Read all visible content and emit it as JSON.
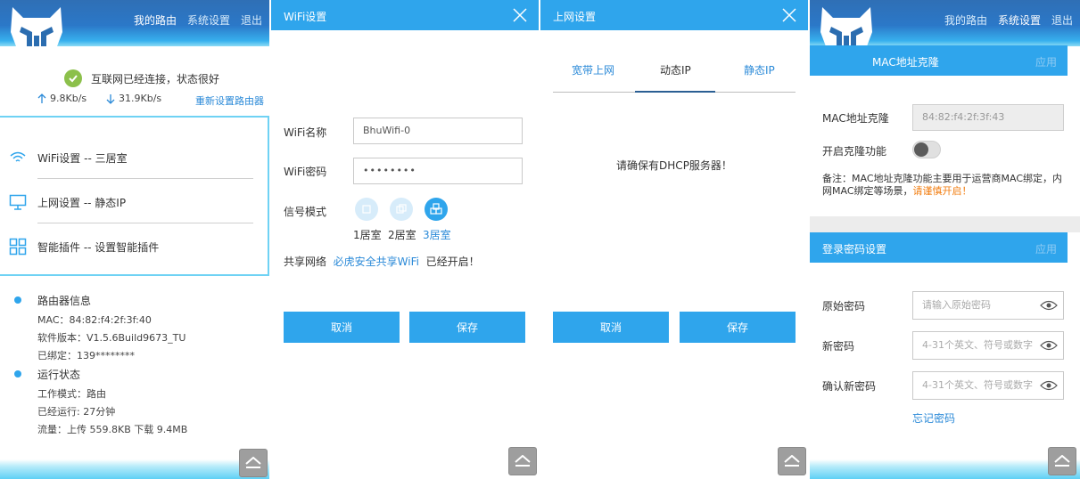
{
  "colors": {
    "primary": "#2fa5ec",
    "link": "#2b8ad8",
    "ok": "#8cc04b",
    "warn": "#f27e12"
  },
  "header": {
    "nav": [
      "我的路由",
      "系统设置",
      "退出"
    ]
  },
  "home": {
    "status_text": "互联网已经连接，状态很好",
    "upload_speed": "9.8Kb/s",
    "download_speed": "31.9Kb/s",
    "reset_link": "重新设置路由器",
    "menu": [
      {
        "label": "WiFi设置 -- 三居室",
        "icon": "wifi-icon"
      },
      {
        "label": "上网设置 -- 静态IP",
        "icon": "monitor-icon"
      },
      {
        "label": "智能插件 -- 设置智能插件",
        "icon": "grid-icon"
      }
    ],
    "router_info_title": "路由器信息",
    "router_info": [
      "MAC：84:82:f4:2f:3f:40",
      "软件版本：V1.5.6Build9673_TU",
      "已绑定：139********"
    ],
    "run_status_title": "运行状态",
    "run_status": [
      "工作模式：路由",
      "已经运行: 27分钟",
      "流量：上传 559.8KB 下载 9.4MB"
    ]
  },
  "wifi_dialog": {
    "title": "WiFi设置",
    "name_label": "WiFi名称",
    "name_value": "BhuWifi-0",
    "password_label": "WiFi密码",
    "password_value": "••••••••",
    "mode_label": "信号模式",
    "modes": [
      "1居室",
      "2居室",
      "3居室"
    ],
    "selected_mode": 2,
    "share_label": "共享网络",
    "share_link": "必虎安全共享WiFi",
    "share_status": "已经开启！",
    "cancel": "取消",
    "save": "保存"
  },
  "net_dialog": {
    "title": "上网设置",
    "tabs": [
      "宽带上网",
      "动态IP",
      "静态IP"
    ],
    "active_tab": 1,
    "message": "请确保有DHCP服务器！",
    "cancel": "取消",
    "save": "保存"
  },
  "settings": {
    "mac_section_title": "MAC地址克隆",
    "apply": "应用",
    "mac_label": "MAC地址克隆",
    "mac_value": "84:82:f4:2f:3f:43",
    "clone_label": "开启克隆功能",
    "clone_enabled": false,
    "note_text": "备注：MAC地址克隆功能主要用于运营商MAC绑定，内网MAC绑定等场景，",
    "note_warn": "请谨慎开启！",
    "pw_section_title": "登录密码设置",
    "old_pw_label": "原始密码",
    "old_pw_placeholder": "请输入原始密码",
    "new_pw_label": "新密码",
    "new_pw_placeholder": "4-31个英文、符号或数字",
    "confirm_pw_label": "确认新密码",
    "confirm_pw_placeholder": "4-31个英文、符号或数字",
    "forgot": "忘记密码"
  }
}
